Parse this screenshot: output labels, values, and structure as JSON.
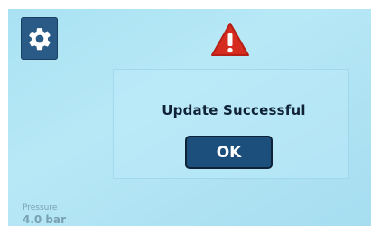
{
  "screen": {
    "background": "#aee3f4"
  },
  "toolbar": {
    "settings_icon": "gear-icon",
    "settings_color": "#2a5a86"
  },
  "alert": {
    "icon": "warning-triangle-icon",
    "icon_color": "#d62b1f",
    "message": "Update Successful",
    "ok_label": "OK",
    "ok_color": "#1d4f7c"
  },
  "status": {
    "pressure_label": "Pressure",
    "pressure_value": "4.0 bar"
  }
}
